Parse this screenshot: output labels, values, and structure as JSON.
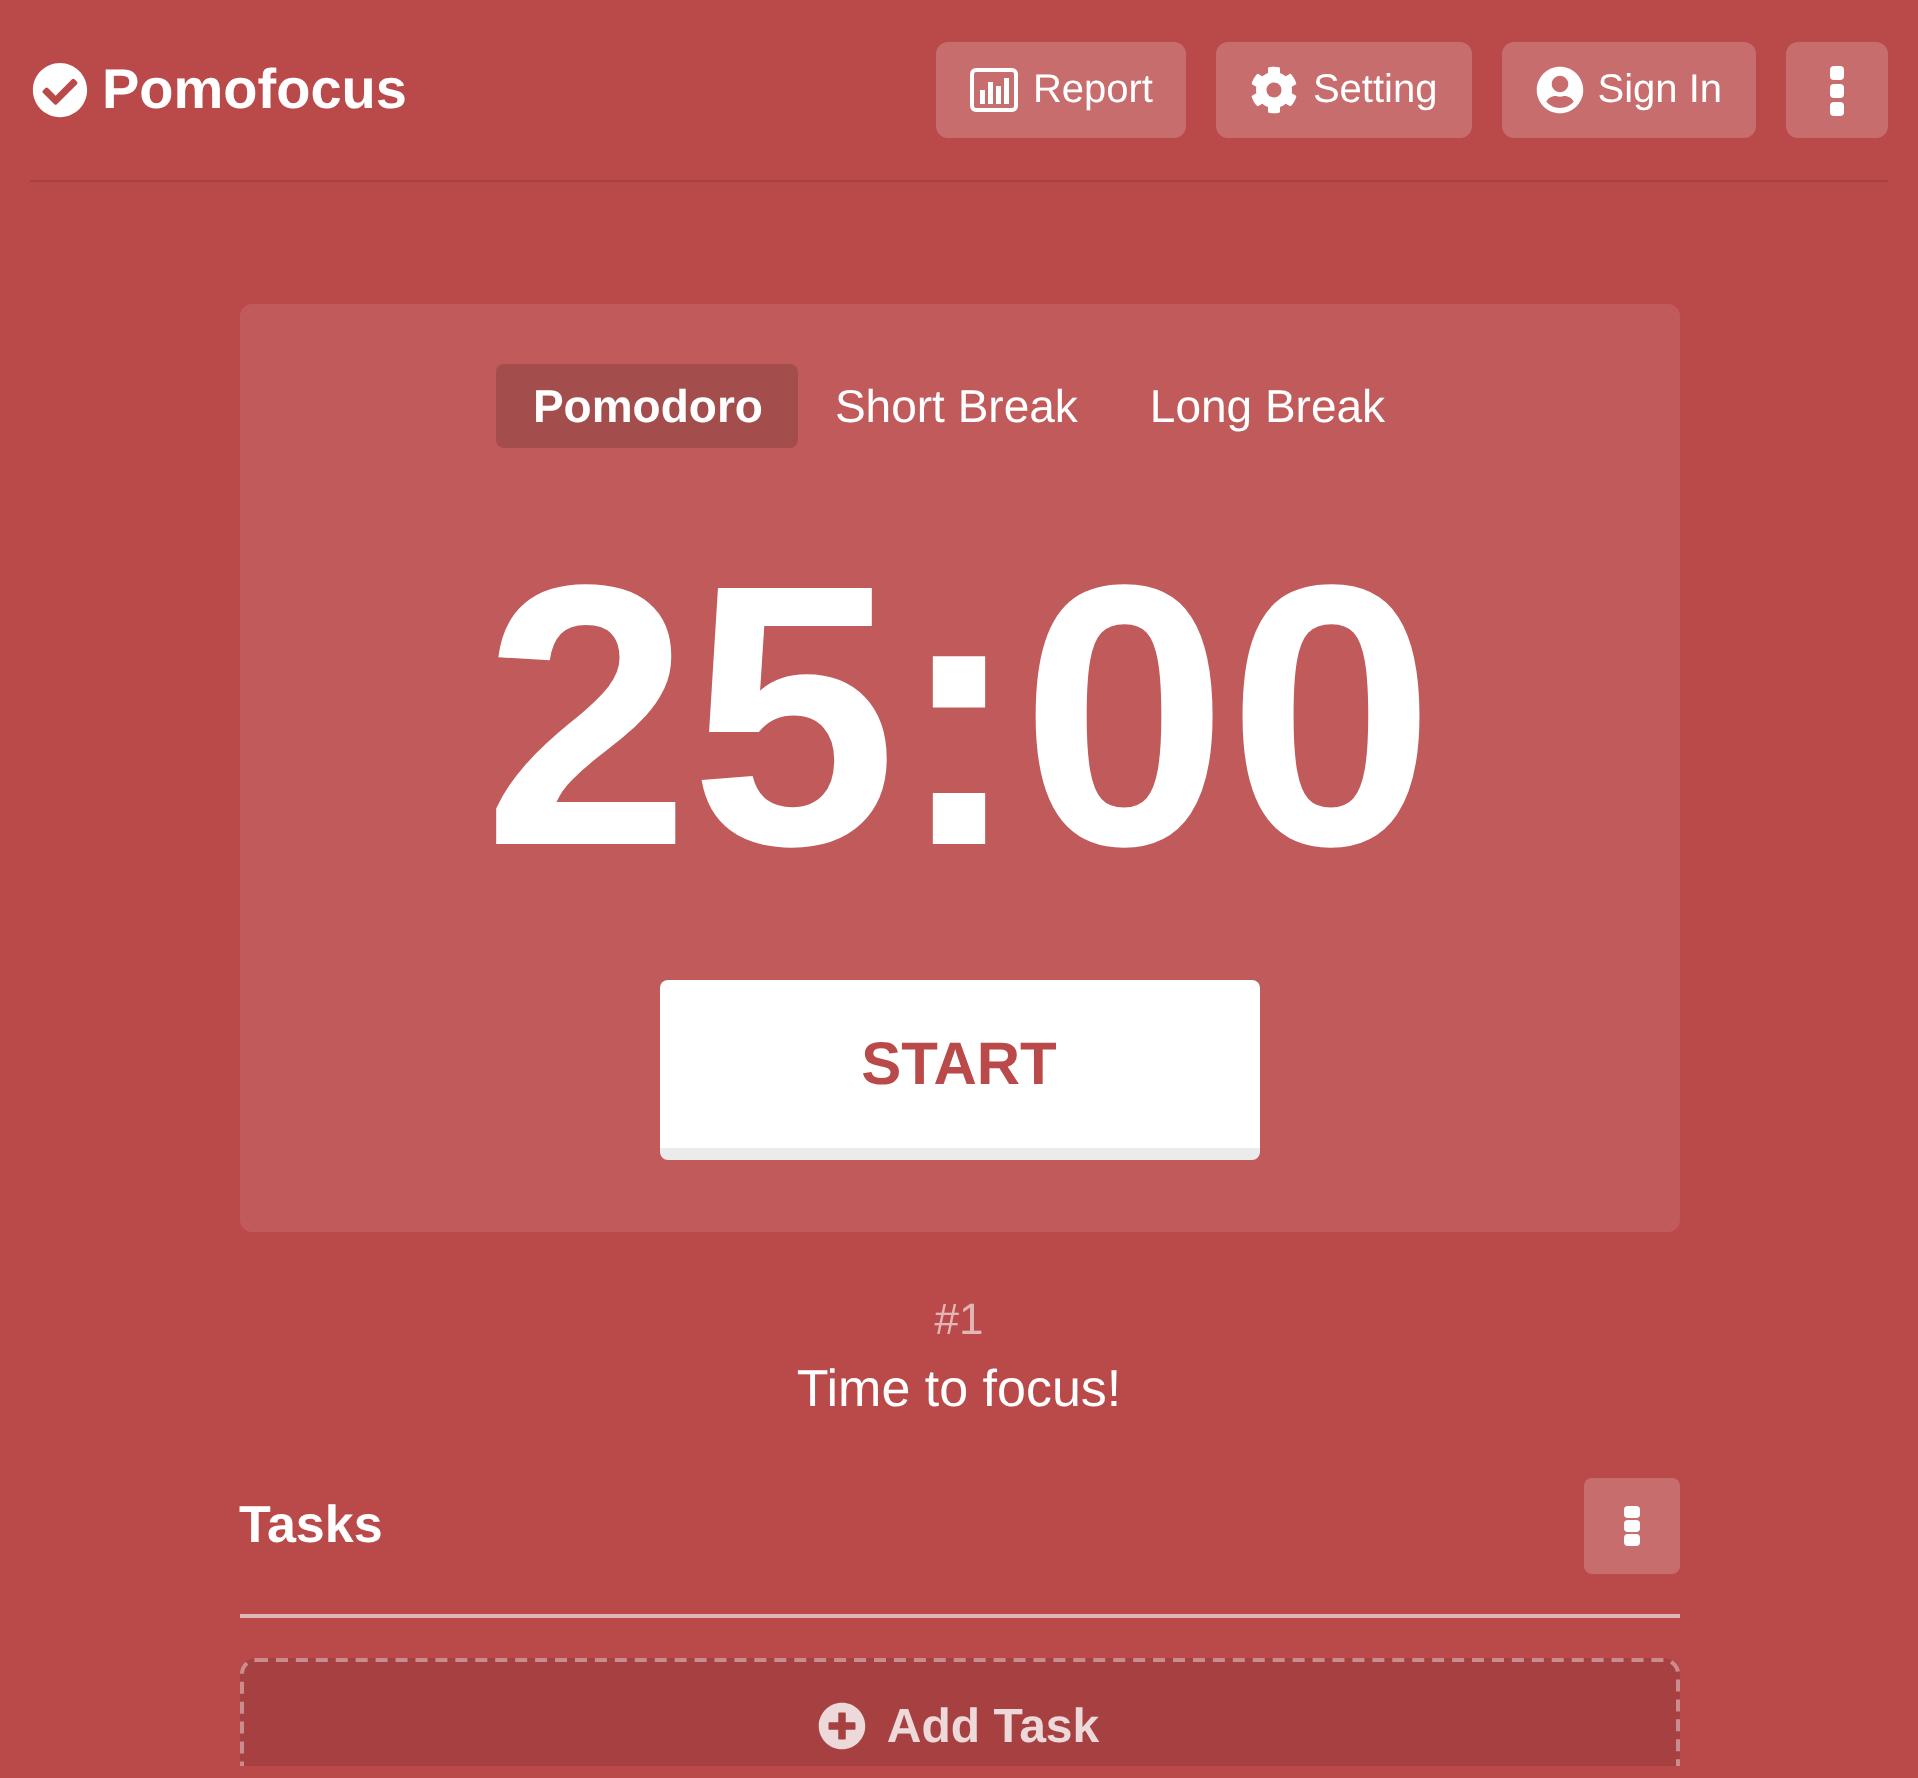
{
  "header": {
    "logo": "Pomofocus",
    "buttons": [
      {
        "kind": "report",
        "label": "Report"
      },
      {
        "kind": "setting",
        "label": "Setting"
      },
      {
        "kind": "sign_in",
        "label": "Sign In"
      },
      {
        "kind": "menu"
      }
    ]
  },
  "timer": {
    "tabs": [
      {
        "label": "Pomodoro",
        "selected": true
      },
      {
        "label": "Short Break",
        "selected": false
      },
      {
        "label": "Long Break",
        "selected": false
      }
    ],
    "time": "25:00",
    "button": "START"
  },
  "session": {
    "count": "#1",
    "message": "Time to focus!"
  },
  "tasks": {
    "title": "Tasks",
    "add_button": "Add Task"
  }
}
